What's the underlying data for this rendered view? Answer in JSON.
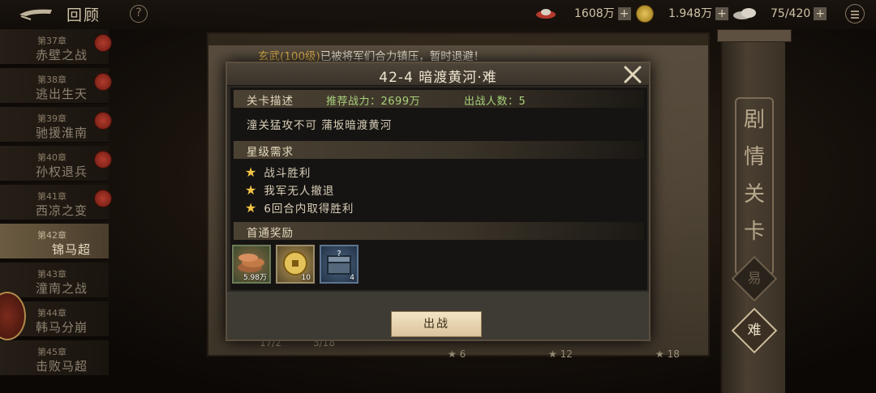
{
  "topbar": {
    "title": "回顾",
    "help": "?",
    "resources": [
      {
        "icon": "ingot-icon",
        "value": "1608万"
      },
      {
        "icon": "coin-icon",
        "value": "1.948万"
      },
      {
        "icon": "stamina-icon",
        "value": "75/420"
      }
    ],
    "plus": "+"
  },
  "chapters": [
    {
      "num": "第37章",
      "name": "赤壁之战"
    },
    {
      "num": "第38章",
      "name": "逃出生天"
    },
    {
      "num": "第39章",
      "name": "驰援淮南"
    },
    {
      "num": "第40章",
      "name": "孙权退兵"
    },
    {
      "num": "第41章",
      "name": "西凉之变"
    },
    {
      "num": "第42章",
      "name": "锦马超",
      "active": true
    },
    {
      "num": "第43章",
      "name": "潼南之战"
    },
    {
      "num": "第44章",
      "name": "韩马分崩"
    },
    {
      "num": "第45章",
      "name": "击败马超"
    }
  ],
  "right_panel": {
    "title_chars": [
      "剧",
      "情",
      "关",
      "卡"
    ],
    "difficulty": {
      "easy": "易",
      "hard": "难"
    }
  },
  "announcement": {
    "prefix": "玄武",
    "level": "(100级)",
    "text": "已被将军们合力镇压，暂时退避！"
  },
  "dialog": {
    "title": "42-4 暗渡黄河·难",
    "stage_desc_label": "关卡描述",
    "recommended_power": "推荐战力：2699万",
    "deploy_count": "出战人数：5",
    "description": "潼关猛攻不可 蒲坂暗渡黄河",
    "star_req_label": "星级需求",
    "star_requirements": [
      "战斗胜利",
      "我军无人撤退",
      "6回合内取得胜利"
    ],
    "first_clear_label": "首通奖励",
    "rewards": [
      {
        "icon": "copper-coins-icon",
        "count": "5.98万"
      },
      {
        "icon": "gold-coin-icon",
        "count": "10"
      },
      {
        "icon": "mystery-chest-icon",
        "count": "4"
      }
    ],
    "confirm": "出战"
  },
  "bottom_progress": {
    "progress_a": "17/2",
    "progress_b": "3/18",
    "milestones": [
      "6",
      "12",
      "18"
    ]
  }
}
